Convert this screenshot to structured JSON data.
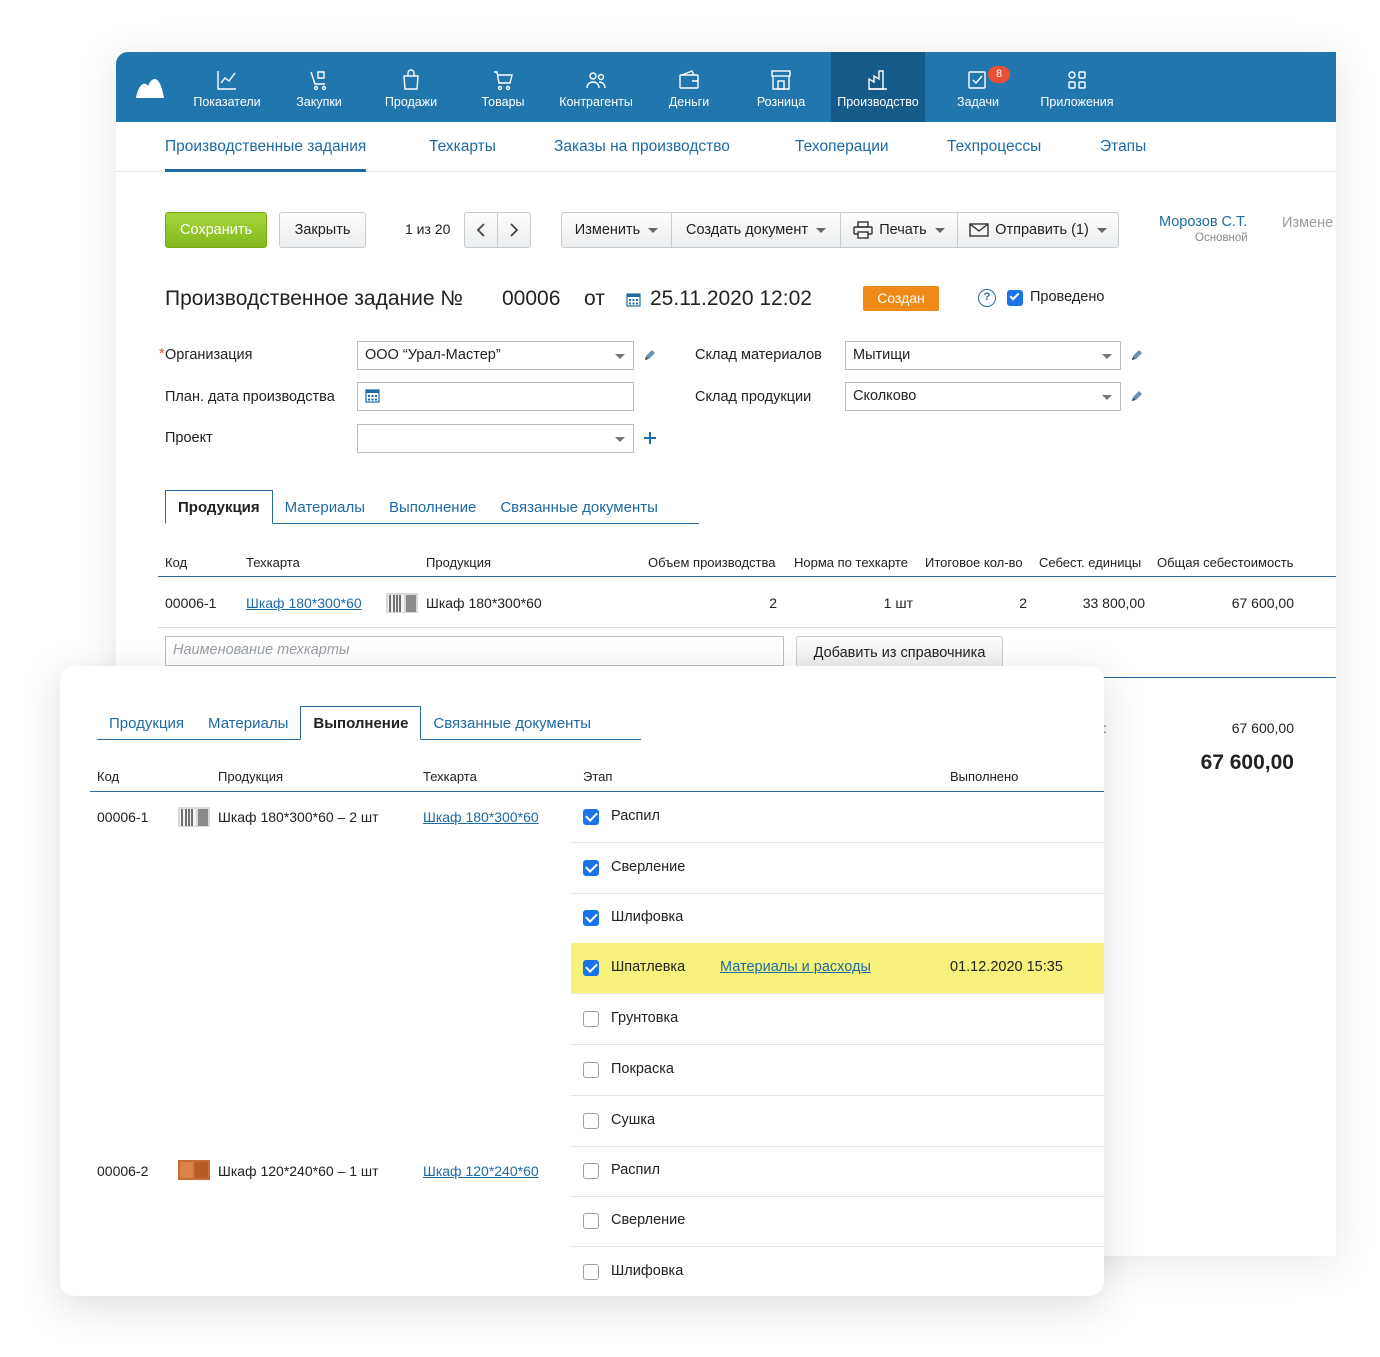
{
  "nav": {
    "items": [
      {
        "label": "Показатели",
        "icon": "chart-icon"
      },
      {
        "label": "Закупки",
        "icon": "purchases-icon"
      },
      {
        "label": "Продажи",
        "icon": "bag-icon"
      },
      {
        "label": "Товары",
        "icon": "cart-icon"
      },
      {
        "label": "Контрагенты",
        "icon": "people-icon"
      },
      {
        "label": "Деньги",
        "icon": "wallet-icon"
      },
      {
        "label": "Розница",
        "icon": "store-icon"
      },
      {
        "label": "Производство",
        "icon": "factory-icon",
        "active": true
      },
      {
        "label": "Задачи",
        "icon": "tasks-icon",
        "badge": "8"
      },
      {
        "label": "Приложения",
        "icon": "apps-icon"
      }
    ]
  },
  "subnav": {
    "tabs": [
      "Производственные задания",
      "Техкарты",
      "Заказы на производство",
      "Техоперации",
      "Техпроцессы",
      "Этапы"
    ]
  },
  "toolbar": {
    "save": "Сохранить",
    "close": "Закрыть",
    "pager": "1 из 20",
    "edit": "Изменить",
    "create_doc": "Создать документ",
    "print": "Печать",
    "send": "Отправить (1)",
    "user_name": "Морозов С.Т.",
    "user_role": "Основной",
    "changed": "Измене"
  },
  "doc": {
    "title": "Производственное задание №",
    "number": "00006",
    "from": "от",
    "date": "25.11.2020 12:02",
    "status": "Создан",
    "posted": "Проведено",
    "help": "?"
  },
  "form": {
    "org_required": "*",
    "org_label": "Организация",
    "org_value": "ООО “Урал-Мастер”",
    "plan_date_label": "План. дата производства",
    "project_label": "Проект",
    "materials_wh_label": "Склад материалов",
    "materials_wh_value": "Мытищи",
    "products_wh_label": "Склад продукции",
    "products_wh_value": "Сколково"
  },
  "main_tabs": [
    "Продукция",
    "Материалы",
    "Выполнение",
    "Связанные документы"
  ],
  "products_table": {
    "headers": [
      "Код",
      "Техкарта",
      "Продукция",
      "Объем производства",
      "Норма по техкарте",
      "Итоговое кол-во",
      "Себест. единицы",
      "Общая себестоимость"
    ],
    "rows": [
      {
        "code": "00006-1",
        "techcard": "Шкаф 180*300*60",
        "product": "Шкаф 180*300*60",
        "volume": "2",
        "norm": "1 шт",
        "total_qty": "2",
        "unit_cost": "33 800,00",
        "total_cost": "67 600,00"
      }
    ],
    "add_placeholder": "Наименование техкарты",
    "add_button": "Добавить из справочника",
    "summary_label_fragment": ":",
    "summary_small": "67 600,00",
    "summary_big": "67 600,00"
  },
  "card": {
    "tabs": [
      "Продукция",
      "Материалы",
      "Выполнение",
      "Связанные документы"
    ],
    "headers": [
      "Код",
      "Продукция",
      "Техкарта",
      "Этап",
      "Выполнено"
    ],
    "products": [
      {
        "code": "00006-1",
        "product": "Шкаф 180*300*60 – 2 шт",
        "techcard": "Шкаф 180*300*60"
      },
      {
        "code": "00006-2",
        "product": "Шкаф 120*240*60 – 1 шт",
        "techcard": "Шкаф 120*240*60"
      }
    ],
    "stages": [
      {
        "name": "Распил",
        "done": true
      },
      {
        "name": "Сверление",
        "done": true
      },
      {
        "name": "Шлифовка",
        "done": true
      },
      {
        "name": "Шпатлевка",
        "done": true,
        "link": "Материалы и расходы",
        "completed": "01.12.2020 15:35"
      },
      {
        "name": "Грунтовка",
        "done": false
      },
      {
        "name": "Покраска",
        "done": false
      },
      {
        "name": "Сушка",
        "done": false
      },
      {
        "name": "Распил",
        "done": false
      },
      {
        "name": "Сверление",
        "done": false
      },
      {
        "name": "Шлифовка",
        "done": false
      }
    ]
  },
  "colors": {
    "topbar": "#2176ae",
    "active_nav": "#145b89",
    "save_green": "#8cc22a",
    "status_orange": "#ef8a17",
    "highlight": "#f7f27b",
    "link": "#1d6aa5"
  }
}
